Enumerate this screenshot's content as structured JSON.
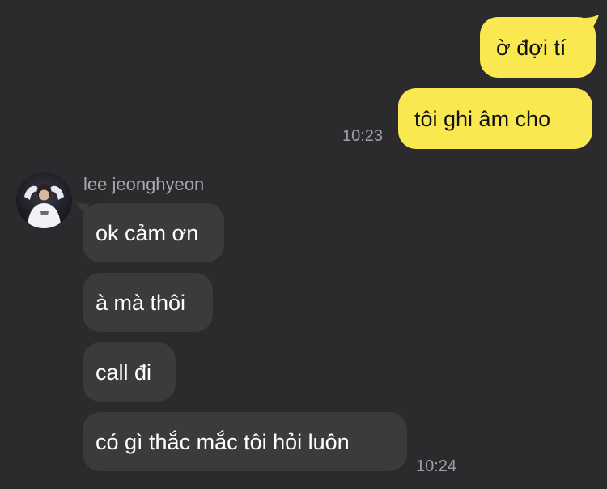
{
  "colors": {
    "background": "#2b2b2d",
    "outgoing_bubble": "#f9e84f",
    "incoming_bubble": "#3b3b3d",
    "timestamp": "#a0a0a4"
  },
  "outgoing": [
    {
      "text": "ờ đợi tí"
    },
    {
      "text": "tôi ghi âm cho"
    }
  ],
  "outgoing_time": "10:23",
  "incoming": {
    "sender_name": "lee jeonghyeon",
    "avatar_icon": "profile-photo-avatar",
    "messages": [
      {
        "text": "ok cảm ơn"
      },
      {
        "text": "à mà thôi"
      },
      {
        "text": "call đi"
      },
      {
        "text": "có gì thắc mắc tôi hỏi luôn"
      }
    ],
    "time": "10:24"
  }
}
